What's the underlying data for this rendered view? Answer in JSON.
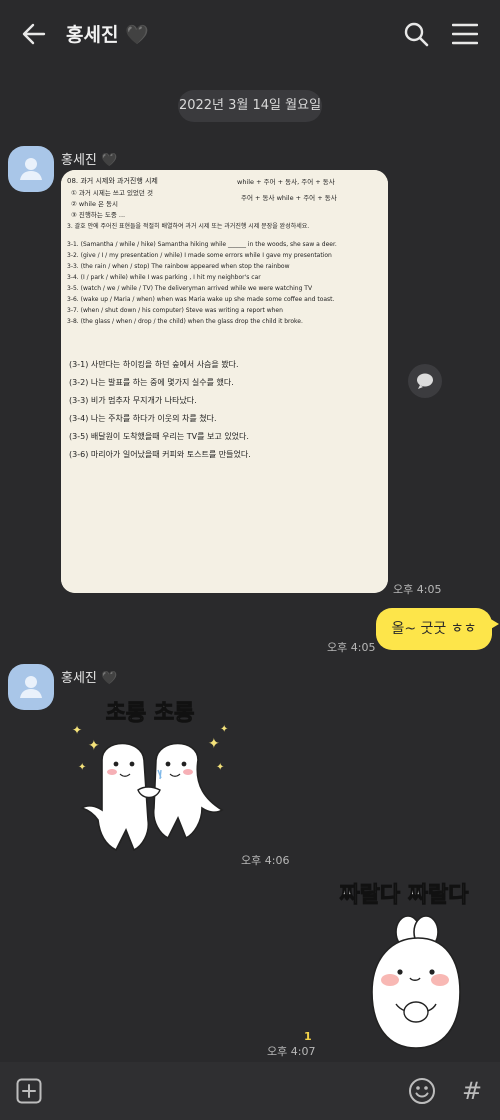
{
  "header": {
    "title": "홍세진",
    "title_emoji": "🖤",
    "back_icon": "back-arrow-icon",
    "search_icon": "search-icon",
    "menu_icon": "hamburger-menu-icon"
  },
  "date_divider": "2022년 3월 14일 월요일",
  "messages": [
    {
      "sender": "홍세진",
      "sender_emoji": "🖤",
      "type": "photo",
      "time": "오후 4:05",
      "photo_text": {
        "heading": "08. 과거 시제와 과거진행 시제",
        "notes_left": [
          "① 과거 시제는 쓰고 있었던 것",
          "② while 은 동시",
          "③ 진행하는 도중 ..."
        ],
        "notes_right": [
          "while + 주어 + 동사, 주어 + 동사",
          "주어 + 동사 while + 주어 + 동사"
        ],
        "instruction": "3. 괄호 안에 주어진 표현들을 적절히 배열하여 과거 시제 또는 과거진행 시제 문장을 완성하세요.",
        "lines": [
          "3-1. (Samantha / while / hike) Samantha hiking while ______ in the woods, she saw a deer.",
          "3-2. (give / I / my presentation / while) I made some errors while I gave my presentation",
          "3-3. (the rain / when / stop) The rainbow appeared when stop the rainbow",
          "3-4. (I / park / while) while I was parking , I hit my neighbor's car",
          "3-5. (watch / we / while / TV) The deliveryman arrived while we were watching TV",
          "3-6. (wake up / Maria / when) when was Maria wake up she made some coffee and toast.",
          "3-7. (when / shut down / his computer) Steve was writing a report when",
          "3-8. (the glass / when / drop / the child) when the glass drop the child it broke."
        ],
        "korean_lines": [
          "(3-1) 사만다는 하이킹을 하던 숲에서 사슴을 봤다.",
          "(3-2) 나는 발표를 하는 중에 몇가지 실수를 했다.",
          "(3-3) 비가 멈추자 무지개가 나타났다.",
          "(3-4) 나는 주차를 하다가 이웃의 차를 쳤다.",
          "(3-5) 배달원이 도착했을때 우리는 TV를 보고 있었다.",
          "(3-6) 마리아가 일어났을때 커피와 토스트를 만들었다."
        ]
      }
    },
    {
      "sender": "me",
      "type": "text",
      "text": "올~ 굿굿 ㅎㅎ",
      "time": "오후 4:05"
    },
    {
      "sender": "홍세진",
      "sender_emoji": "🖤",
      "type": "sticker",
      "sticker_text": "초롱 초롱",
      "time": "오후 4:06"
    },
    {
      "sender": "me",
      "type": "sticker",
      "sticker_text": "짜랄다 짜랄다",
      "time": "오후 4:07",
      "unread_count": "1"
    }
  ],
  "bottom_bar": {
    "add_icon": "plus-square-icon",
    "emoji_icon": "emoji-smile-icon",
    "hash_label": "#"
  },
  "colors": {
    "background": "#2a2a2c",
    "my_bubble": "#fde54a",
    "avatar": "#a9c6e8",
    "unread": "#f2d24a"
  }
}
